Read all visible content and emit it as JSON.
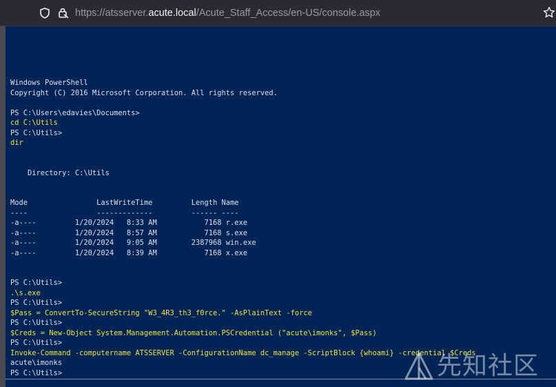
{
  "browser": {
    "url_prefix": "https://atsserver.",
    "url_host": "acute.local",
    "url_path": "/Acute_Staff_Access/en-US/console.aspx",
    "icons": [
      "shield-icon",
      "lock-icon",
      "star-icon"
    ]
  },
  "console": {
    "background_color": "#012456",
    "text_color": "#dde1ea",
    "command_color": "#f0e53e",
    "lines": [
      {
        "text": "Windows PowerShell",
        "type": "output"
      },
      {
        "text": "Copyright (C) 2016 Microsoft Corporation. All rights reserved.",
        "type": "output"
      },
      {
        "text": "",
        "type": "output"
      },
      {
        "text": "PS C:\\Users\\edavies\\Documents>",
        "type": "output"
      },
      {
        "text": "cd C:\\Utils",
        "type": "command"
      },
      {
        "text": "PS C:\\Utils>",
        "type": "output"
      },
      {
        "text": "dir",
        "type": "command"
      },
      {
        "text": "",
        "type": "output"
      },
      {
        "text": "",
        "type": "output"
      },
      {
        "text": "    Directory: C:\\Utils",
        "type": "output"
      },
      {
        "text": "",
        "type": "output"
      },
      {
        "text": "",
        "type": "output"
      },
      {
        "text": "Mode                LastWriteTime         Length Name",
        "type": "output"
      },
      {
        "text": "----                -------------         ------ ----",
        "type": "output"
      },
      {
        "text": "-a----         1/20/2024   8:33 AM           7168 r.exe",
        "type": "output"
      },
      {
        "text": "-a----         1/20/2024   8:57 AM           7168 s.exe",
        "type": "output"
      },
      {
        "text": "-a----         1/20/2024   9:05 AM        2387968 win.exe",
        "type": "output"
      },
      {
        "text": "-a----         1/20/2024   8:39 AM           7168 x.exe",
        "type": "output"
      },
      {
        "text": "",
        "type": "output"
      },
      {
        "text": "",
        "type": "output"
      },
      {
        "text": "PS C:\\Utils>",
        "type": "output"
      },
      {
        "text": ".\\s.exe",
        "type": "command"
      },
      {
        "text": "PS C:\\Utils>",
        "type": "output"
      },
      {
        "text": "$Pass = ConvertTo-SecureString \"W3_4R3_th3_f0rce.\" -AsPlainText -force",
        "type": "command"
      },
      {
        "text": "PS C:\\Utils>",
        "type": "output"
      },
      {
        "text": "$Creds = New-Object System.Management.Automation.PSCredential (\"acute\\imonks\", $Pass)",
        "type": "command"
      },
      {
        "text": "PS C:\\Utils>",
        "type": "output"
      },
      {
        "text": "Invoke-Command -computername ATSSERVER -ConfigurationName dc_manage -ScriptBlock {whoami} -credential $Creds",
        "type": "command"
      },
      {
        "text": "acute\\imonks",
        "type": "output"
      },
      {
        "text": "PS C:\\Utils>",
        "type": "output"
      }
    ]
  },
  "watermark": {
    "text": "先知社区",
    "icon": "xianzhi-logo-icon"
  }
}
